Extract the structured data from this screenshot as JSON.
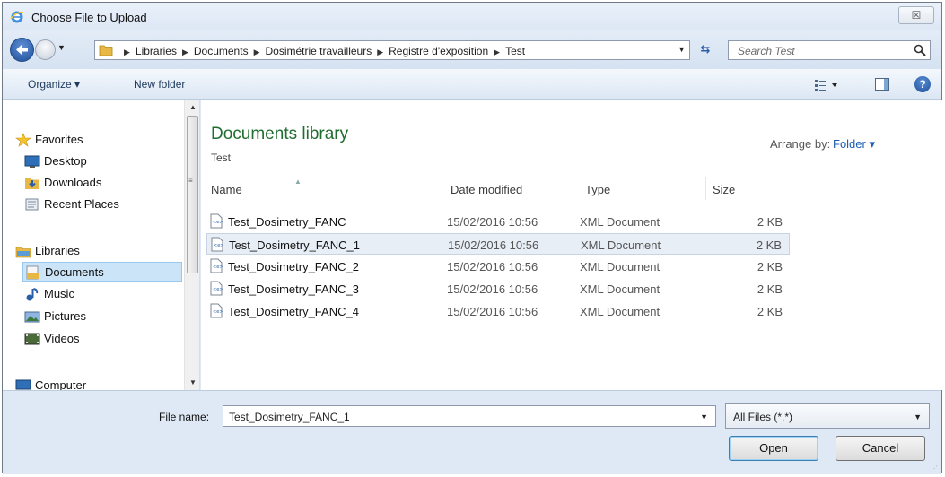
{
  "window": {
    "title": "Choose File to Upload",
    "close_label": "☒"
  },
  "address": {
    "crumbs": [
      "Libraries",
      "Documents",
      "Dosimétrie travailleurs",
      "Registre d'exposition",
      "Test"
    ],
    "search_placeholder": "Search Test"
  },
  "toolbar": {
    "organize_label": "Organize ▾",
    "new_folder_label": "New folder"
  },
  "nav": {
    "items": [
      {
        "label": "Favorites",
        "icon": "star-icon"
      },
      {
        "label": "Desktop",
        "icon": "desktop-icon"
      },
      {
        "label": "Downloads",
        "icon": "downloads-icon"
      },
      {
        "label": "Recent Places",
        "icon": "recent-places-icon"
      },
      {
        "label": "Libraries",
        "icon": "libraries-icon"
      },
      {
        "label": "Documents",
        "icon": "documents-icon",
        "selected": true
      },
      {
        "label": "Music",
        "icon": "music-icon"
      },
      {
        "label": "Pictures",
        "icon": "pictures-icon"
      },
      {
        "label": "Videos",
        "icon": "videos-icon"
      },
      {
        "label": "Computer",
        "icon": "computer-icon"
      }
    ]
  },
  "content": {
    "library_title": "Documents library",
    "library_subtitle": "Test",
    "arrange_label": "Arrange by:",
    "arrange_value": "Folder ▾",
    "columns": {
      "name": "Name",
      "date": "Date modified",
      "type": "Type",
      "size": "Size"
    },
    "files": [
      {
        "name": "Test_Dosimetry_FANC",
        "date": "15/02/2016 10:56",
        "type": "XML Document",
        "size": "2 KB"
      },
      {
        "name": "Test_Dosimetry_FANC_1",
        "date": "15/02/2016 10:56",
        "type": "XML Document",
        "size": "2 KB",
        "selected": true
      },
      {
        "name": "Test_Dosimetry_FANC_2",
        "date": "15/02/2016 10:56",
        "type": "XML Document",
        "size": "2 KB"
      },
      {
        "name": "Test_Dosimetry_FANC_3",
        "date": "15/02/2016 10:56",
        "type": "XML Document",
        "size": "2 KB"
      },
      {
        "name": "Test_Dosimetry_FANC_4",
        "date": "15/02/2016 10:56",
        "type": "XML Document",
        "size": "2 KB"
      }
    ]
  },
  "bottom": {
    "file_name_label": "File name:",
    "file_name_value": "Test_Dosimetry_FANC_1",
    "filter_value": "All Files (*.*)",
    "open_label": "Open",
    "cancel_label": "Cancel"
  },
  "colors": {
    "library_title": "#1f6e2f",
    "link_blue": "#1d5fb3",
    "selection_bg": "#cce4f7"
  }
}
